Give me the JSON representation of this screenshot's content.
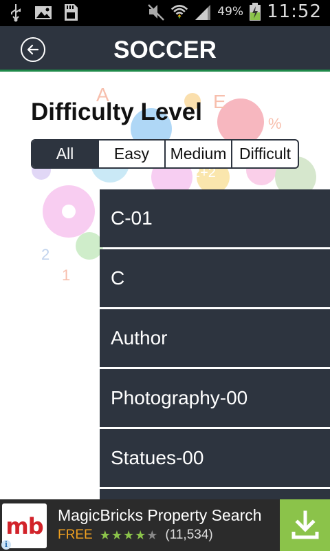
{
  "status_bar": {
    "icons": [
      "usb-icon",
      "image-icon",
      "sd-card-icon",
      "mute-icon",
      "wifi-icon",
      "signal-icon",
      "battery-charging-icon"
    ],
    "battery_percent": "49%",
    "time": "11:52"
  },
  "header": {
    "title": "SOCCER",
    "back_icon": "back-arrow-icon",
    "accent_color": "#1f8a4a",
    "bar_color": "#2d343f"
  },
  "filter": {
    "label": "Difficulty Level",
    "options": [
      "All",
      "Easy",
      "Medium",
      "Difficult"
    ],
    "selected": "All"
  },
  "list": {
    "items": [
      "C-01",
      "C",
      "Author",
      "Photography-00",
      "Statues-00",
      ""
    ]
  },
  "ad": {
    "logo_text": "mb",
    "title": "MagicBricks Property Search",
    "price": "FREE",
    "rating_stars": 4,
    "rating_count": "(11,534)",
    "download_icon": "download-icon",
    "info_icon": "info-icon"
  }
}
